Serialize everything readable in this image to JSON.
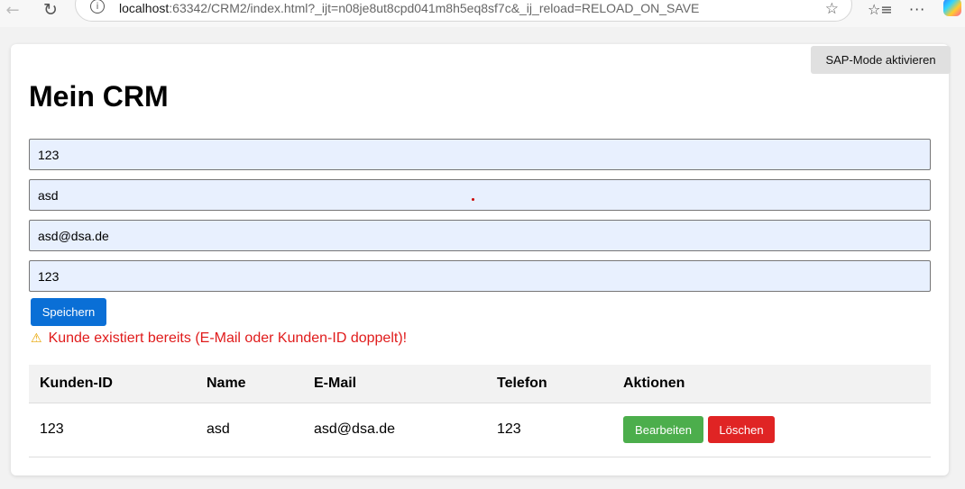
{
  "browser": {
    "url_host": "localhost",
    "url_rest": ":63342/CRM2/index.html?_ijt=n08je8ut8cpd041m8h5eq8sf7c&_ij_reload=RELOAD_ON_SAVE"
  },
  "header": {
    "sap_button_label": "SAP-Mode aktivieren",
    "title": "Mein CRM"
  },
  "form": {
    "fields": [
      {
        "value": "123"
      },
      {
        "value": "asd"
      },
      {
        "value": "asd@dsa.de"
      },
      {
        "value": "123"
      }
    ],
    "save_label": "Speichern",
    "error_message": "Kunde existiert bereits (E-Mail oder Kunden-ID doppelt)!"
  },
  "table": {
    "headers": [
      "Kunden-ID",
      "Name",
      "E-Mail",
      "Telefon",
      "Aktionen"
    ],
    "rows": [
      {
        "id": "123",
        "name": "asd",
        "email": "asd@dsa.de",
        "phone": "123",
        "edit_label": "Bearbeiten",
        "delete_label": "Löschen"
      }
    ]
  },
  "colors": {
    "save_button": "#0a6fd6",
    "edit_button": "#4cae4c",
    "delete_button": "#e02424",
    "error_text": "#e01b1b",
    "input_background": "#e8f0fe"
  },
  "icons": [
    "back-arrow-icon",
    "reload-icon",
    "site-info-icon",
    "favorite-star-icon",
    "favorites-list-icon",
    "more-menu-icon",
    "copilot-icon",
    "warning-icon"
  ]
}
